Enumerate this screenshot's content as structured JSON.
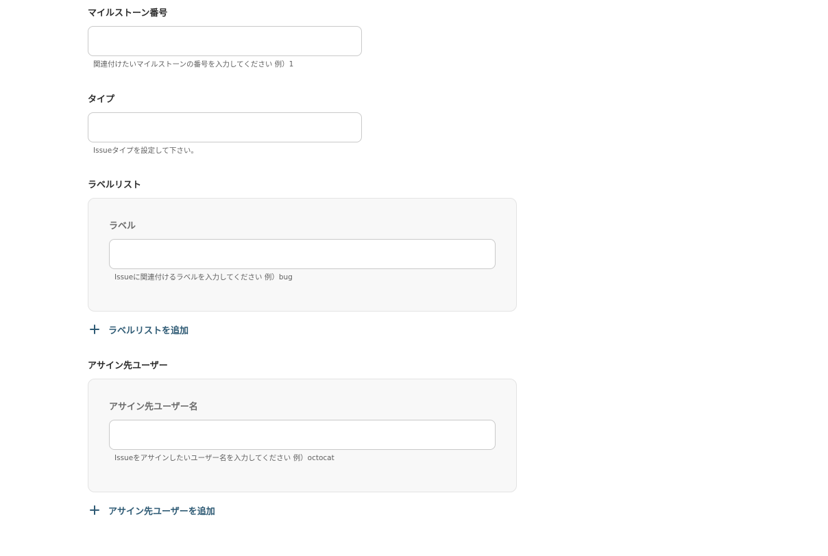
{
  "milestone": {
    "label": "マイルストーン番号",
    "value": "",
    "help": "関連付けたいマイルストーンの番号を入力してください 例）1"
  },
  "type": {
    "label": "タイプ",
    "value": "",
    "help": "Issueタイプを設定して下さい。"
  },
  "label_list": {
    "title": "ラベルリスト",
    "item_label": "ラベル",
    "value": "",
    "help": "Issueに関連付けるラベルを入力してください 例）bug",
    "add_label": "ラベルリストを追加"
  },
  "assignees": {
    "title": "アサイン先ユーザー",
    "item_label": "アサイン先ユーザー名",
    "value": "",
    "help": "Issueをアサインしたいユーザー名を入力してください 例）octocat",
    "add_label": "アサイン先ユーザーを追加"
  },
  "icons": {
    "add": "plus-icon"
  },
  "colors": {
    "accent": "#2e5a74",
    "input_border": "#c9c9c9",
    "group_bg": "#f8f8f8",
    "group_border": "#e3e3e3"
  }
}
